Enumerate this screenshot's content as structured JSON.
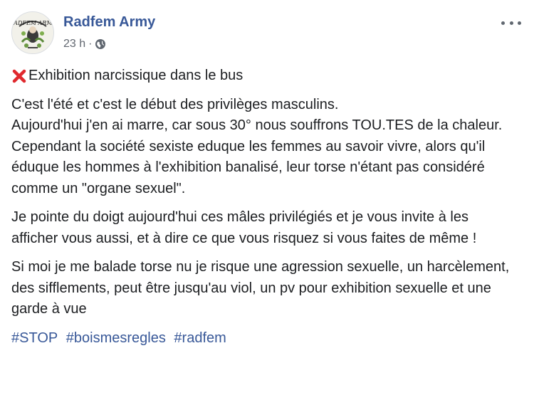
{
  "post": {
    "author": "Radfem Army",
    "time": "23 h",
    "separator": "·",
    "avatar_text": "RADFEM ARMY",
    "title": "Exhibition narcissique dans le bus",
    "paragraphs": [
      [
        "C'est l'été et c'est le début des privilèges masculins.",
        "Aujourd'hui j'en ai marre, car sous 30° nous souffrons TOU.TES de la chaleur.",
        "Cependant la société sexiste eduque les femmes au savoir vivre, alors qu'il éduque les hommes à l'exhibition banalisé, leur torse n'étant pas considéré comme un \"organe sexuel\"."
      ],
      [
        "Je pointe du doigt aujourd'hui ces mâles privilégiés et je vous invite à les afficher vous aussi, et à dire ce que vous risquez si vous faites de même !"
      ],
      [
        "Si moi je me balade torse nu je risque une agression sexuelle, un harcèlement, des sifflements, peut être jusqu'au viol, un pv pour exhibition sexuelle et une garde à vue"
      ]
    ],
    "hashtags": [
      "#STOP",
      "#boismesregles",
      "#radfem"
    ]
  },
  "icons": {
    "avatar": "radfem-army-logo",
    "privacy": "globe-icon",
    "menu": "more-options-icon",
    "title_prefix": "cross-mark-icon"
  },
  "colors": {
    "link": "#385898",
    "text": "#1c1e21",
    "meta": "#616770",
    "cross": "#e0292e"
  }
}
